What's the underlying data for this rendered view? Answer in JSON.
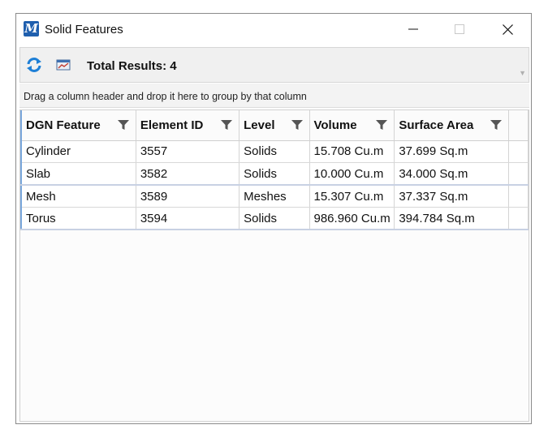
{
  "window": {
    "title": "Solid Features",
    "app_icon_glyph": "M",
    "minimize_icon": "minimize-icon",
    "maximize_icon": "maximize-icon",
    "close_icon": "close-icon"
  },
  "toolbar": {
    "refresh_icon": "refresh-icon",
    "export_icon": "export-image-icon",
    "total_results": "Total Results: 4"
  },
  "group_panel": {
    "hint": "Drag a column header and drop it here to group by that column"
  },
  "table": {
    "columns": [
      "DGN Feature",
      "Element ID",
      "Level",
      "Volume",
      "Surface Area"
    ],
    "rows": [
      [
        "Cylinder",
        "3557",
        "Solids",
        "15.708 Cu.m",
        "37.699 Sq.m"
      ],
      [
        "Slab",
        "3582",
        "Solids",
        "10.000 Cu.m",
        "34.000 Sq.m"
      ],
      [
        "Mesh",
        "3589",
        "Meshes",
        "15.307 Cu.m",
        "37.337 Sq.m"
      ],
      [
        "Torus",
        "3594",
        "Solids",
        "986.960 Cu.m",
        "394.784 Sq.m"
      ]
    ]
  },
  "colors": {
    "accent": "#1f5fae",
    "row_indicator": "#7aa7dc",
    "toolbar_bg": "#f0f0f0"
  }
}
